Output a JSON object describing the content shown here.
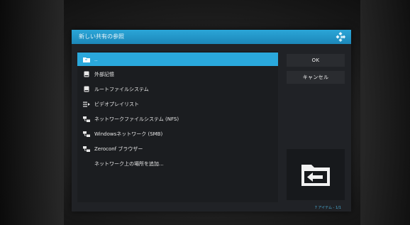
{
  "dialog": {
    "title": "新しい共有の参照",
    "items": [
      {
        "label": "..",
        "icon": "folder-icon",
        "selected": true
      },
      {
        "label": "外部記憶",
        "icon": "removable-drive-icon"
      },
      {
        "label": "ルートファイルシステム",
        "icon": "hard-drive-icon"
      },
      {
        "label": "ビデオプレイリスト",
        "icon": "playlist-icon"
      },
      {
        "label": "ネットワークファイルシステム (NFS)",
        "icon": "network-icon"
      },
      {
        "label": "Windowsネットワーク (SMB)",
        "icon": "network-icon"
      },
      {
        "label": "Zeroconf ブラウザー",
        "icon": "network-icon"
      },
      {
        "label": "ネットワーク上の場所を追加...",
        "icon": ""
      }
    ],
    "buttons": {
      "ok": "OK",
      "cancel": "キャンセル"
    },
    "preview_icon": "folder-back-icon",
    "footer": "7 アイテム - 1/1",
    "colors": {
      "accent": "#2aa8dc",
      "background": "#202226"
    }
  }
}
